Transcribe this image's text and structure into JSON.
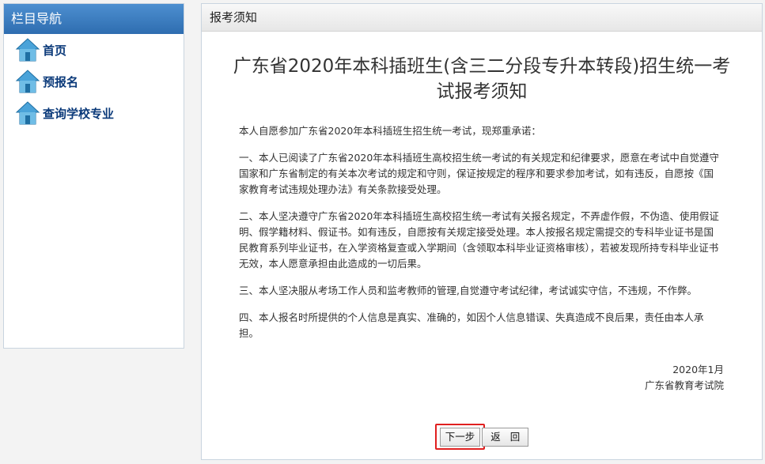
{
  "sidebar": {
    "title": "栏目导航",
    "items": [
      {
        "label": "首页",
        "icon": "home-icon"
      },
      {
        "label": "预报名",
        "icon": "home-icon"
      },
      {
        "label": "查询学校专业",
        "icon": "home-icon"
      }
    ]
  },
  "main": {
    "header": "报考须知",
    "title": "广东省2020年本科插班生(含三二分段专升本转段)招生统一考试报考须知",
    "paragraphs": [
      "本人自愿参加广东省2020年本科插班生招生统一考试，现郑重承诺：",
      "一、本人已阅读了广东省2020年本科插班生高校招生统一考试的有关规定和纪律要求，愿意在考试中自觉遵守国家和广东省制定的有关本次考试的规定和守则，保证按规定的程序和要求参加考试，如有违反，自愿按《国家教育考试违规处理办法》有关条款接受处理。",
      "二、本人坚决遵守广东省2020年本科插班生高校招生统一考试有关报名规定，不弄虚作假，不伪造、使用假证明、假学籍材料、假证书。如有违反，自愿按有关规定接受处理。本人按报名规定需提交的专科毕业证书是国民教育系列毕业证书，在入学资格复查或入学期间（含领取本科毕业证资格审核），若被发现所持专科毕业证书无效，本人愿意承担由此造成的一切后果。",
      "三、本人坚决服从考场工作人员和监考教师的管理,自觉遵守考试纪律，考试诚实守信，不违规，不作弊。",
      "四、本人报名时所提供的个人信息是真实、准确的，如因个人信息错误、失真造成不良后果，责任由本人承担。"
    ],
    "date": "2020年1月",
    "org": "广东省教育考试院",
    "next_label": "下一步",
    "back_label": "返 回"
  },
  "colors": {
    "sidebar_header": "#3a7cc0",
    "nav_text": "#0b3a7a",
    "highlight_border": "#e02020"
  }
}
